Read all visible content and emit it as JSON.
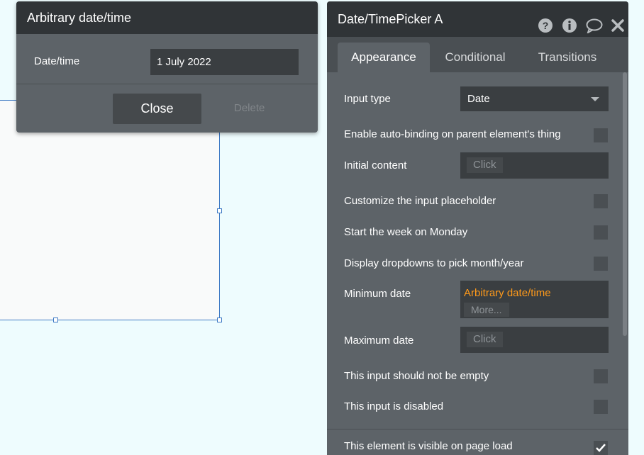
{
  "popup": {
    "title": "Arbitrary date/time",
    "field_label": "Date/time",
    "field_value": "1 July 2022",
    "close_label": "Close",
    "delete_label": "Delete"
  },
  "panel": {
    "title": "Date/TimePicker A",
    "icons": [
      "help-icon",
      "info-icon",
      "comment-icon",
      "close-icon"
    ],
    "tabs": [
      "Appearance",
      "Conditional",
      "Transitions"
    ],
    "active_tab": "Appearance",
    "props": {
      "input_type_label": "Input type",
      "input_type_value": "Date",
      "auto_binding_label": "Enable auto-binding on parent element's thing",
      "initial_content_label": "Initial content",
      "click_placeholder": "Click",
      "custom_placeholder_label": "Customize the input placeholder",
      "start_monday_label": "Start the week on Monday",
      "dropdowns_label": "Display dropdowns to pick month/year",
      "min_date_label": "Minimum date",
      "min_date_value": "Arbitrary date/time",
      "more_label": "More...",
      "max_date_label": "Maximum date",
      "not_empty_label": "This input should not be empty",
      "disabled_label": "This input is disabled",
      "visible_label": "This element is visible on page load",
      "visible_checked": true
    }
  },
  "colors": {
    "accent_orange": "#ff9a1a",
    "selection_blue": "#3d79c4"
  }
}
